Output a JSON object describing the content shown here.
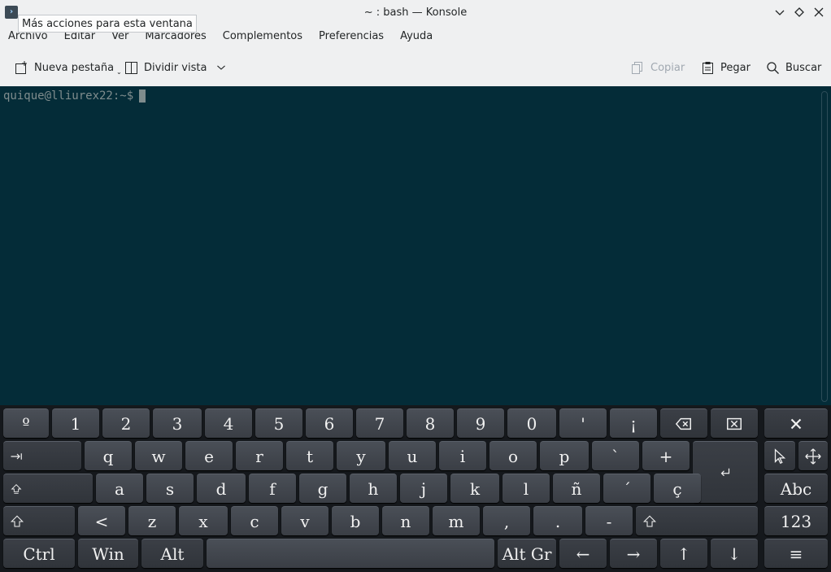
{
  "window": {
    "title": "~ : bash — Konsole",
    "tooltip": "Más acciones para esta ventana"
  },
  "menubar": {
    "items": [
      "Archivo",
      "Editar",
      "Ver",
      "Marcadores",
      "Complementos",
      "Preferencias",
      "Ayuda"
    ]
  },
  "toolbar": {
    "new_tab": "Nueva pestaña",
    "split_view": "Dividir vista",
    "copy": "Copiar",
    "paste": "Pegar",
    "search": "Buscar"
  },
  "terminal": {
    "prompt": "quique@lliurex22:~$"
  },
  "keyboard": {
    "row1": [
      "º",
      "1",
      "2",
      "3",
      "4",
      "5",
      "6",
      "7",
      "8",
      "9",
      "0",
      "'",
      "¡"
    ],
    "row2": [
      "q",
      "w",
      "e",
      "r",
      "t",
      "y",
      "u",
      "i",
      "o",
      "p",
      "`",
      "+"
    ],
    "row3": [
      "a",
      "s",
      "d",
      "f",
      "g",
      "h",
      "j",
      "k",
      "l",
      "ñ",
      "´",
      "ç"
    ],
    "row4": [
      "<",
      "z",
      "x",
      "c",
      "v",
      "b",
      "n",
      "m",
      ",",
      ".",
      "-"
    ],
    "abc": "Abc",
    "num": "123",
    "ctrl": "Ctrl",
    "win": "Win",
    "alt": "Alt",
    "altgr": "Alt Gr",
    "left": "←",
    "right": "→",
    "up": "↑",
    "down": "↓",
    "menu": "≡"
  },
  "colors": {
    "terminal_bg": "#042c38",
    "prompt": "#7f8c8d",
    "keyboard_bg": "#15181c"
  }
}
